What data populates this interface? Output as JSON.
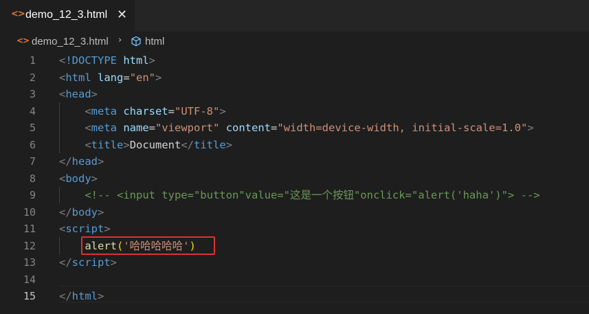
{
  "tab": {
    "icon": "code-brackets-icon",
    "label": "demo_12_3.html",
    "close_icon": "close-icon",
    "close": "✕"
  },
  "breadcrumb": {
    "file_icon": "code-brackets-icon",
    "file": "demo_12_3.html",
    "separator": "›",
    "element_icon": "cube-icon",
    "element": "html"
  },
  "editor": {
    "active_line": 15,
    "lines": [
      {
        "n": "1",
        "tokens": [
          [
            "p",
            "<"
          ],
          [
            "t",
            "!DOCTYPE"
          ],
          [
            "d",
            " "
          ],
          [
            "a",
            "html"
          ],
          [
            "p",
            ">"
          ]
        ]
      },
      {
        "n": "2",
        "tokens": [
          [
            "p",
            "<"
          ],
          [
            "t",
            "html"
          ],
          [
            "d",
            " "
          ],
          [
            "a",
            "lang"
          ],
          [
            "d",
            "="
          ],
          [
            "s",
            "\"en\""
          ],
          [
            "p",
            ">"
          ]
        ]
      },
      {
        "n": "3",
        "tokens": [
          [
            "p",
            "<"
          ],
          [
            "t",
            "head"
          ],
          [
            "p",
            ">"
          ]
        ]
      },
      {
        "n": "4",
        "tokens": [
          [
            "d",
            "    "
          ],
          [
            "p",
            "<"
          ],
          [
            "t",
            "meta"
          ],
          [
            "d",
            " "
          ],
          [
            "a",
            "charset"
          ],
          [
            "d",
            "="
          ],
          [
            "s",
            "\"UTF-8\""
          ],
          [
            "p",
            ">"
          ]
        ]
      },
      {
        "n": "5",
        "tokens": [
          [
            "d",
            "    "
          ],
          [
            "p",
            "<"
          ],
          [
            "t",
            "meta"
          ],
          [
            "d",
            " "
          ],
          [
            "a",
            "name"
          ],
          [
            "d",
            "="
          ],
          [
            "s",
            "\"viewport\""
          ],
          [
            "d",
            " "
          ],
          [
            "a",
            "content"
          ],
          [
            "d",
            "="
          ],
          [
            "s",
            "\"width=device-width, initial-scale=1.0\""
          ],
          [
            "p",
            ">"
          ]
        ]
      },
      {
        "n": "6",
        "tokens": [
          [
            "d",
            "    "
          ],
          [
            "p",
            "<"
          ],
          [
            "t",
            "title"
          ],
          [
            "p",
            ">"
          ],
          [
            "d",
            "Document"
          ],
          [
            "p",
            "</"
          ],
          [
            "t",
            "title"
          ],
          [
            "p",
            ">"
          ]
        ]
      },
      {
        "n": "7",
        "tokens": [
          [
            "p",
            "</"
          ],
          [
            "t",
            "head"
          ],
          [
            "p",
            ">"
          ]
        ]
      },
      {
        "n": "8",
        "tokens": [
          [
            "p",
            "<"
          ],
          [
            "t",
            "body"
          ],
          [
            "p",
            ">"
          ]
        ]
      },
      {
        "n": "9",
        "tokens": [
          [
            "d",
            "    "
          ],
          [
            "c",
            "<!-- <input type=\"button\"value=\"这是一个按钮\"onclick=\"alert('haha')\"> -->"
          ]
        ]
      },
      {
        "n": "10",
        "tokens": [
          [
            "p",
            "</"
          ],
          [
            "t",
            "body"
          ],
          [
            "p",
            ">"
          ]
        ]
      },
      {
        "n": "11",
        "tokens": [
          [
            "p",
            "<"
          ],
          [
            "t",
            "script"
          ],
          [
            "p",
            ">"
          ]
        ]
      },
      {
        "n": "12",
        "tokens": [
          [
            "d",
            "    "
          ],
          [
            "f",
            "alert"
          ],
          [
            "y",
            "("
          ],
          [
            "s",
            "'哈哈哈哈哈'"
          ],
          [
            "y",
            ")"
          ]
        ]
      },
      {
        "n": "13",
        "tokens": [
          [
            "p",
            "</"
          ],
          [
            "t",
            "script"
          ],
          [
            "p",
            ">"
          ]
        ]
      },
      {
        "n": "14",
        "tokens": []
      },
      {
        "n": "15",
        "tokens": [
          [
            "p",
            "</"
          ],
          [
            "t",
            "html"
          ],
          [
            "p",
            ">"
          ]
        ]
      }
    ]
  },
  "colors": {
    "background": "#1e1e1e",
    "tag": "#569cd6",
    "attribute": "#9cdcfe",
    "string": "#ce9178",
    "comment": "#6a9955",
    "function": "#dcdcaa",
    "bracket": "#ffd700",
    "highlight_box": "#e0312f",
    "file_icon": "#e37933"
  }
}
